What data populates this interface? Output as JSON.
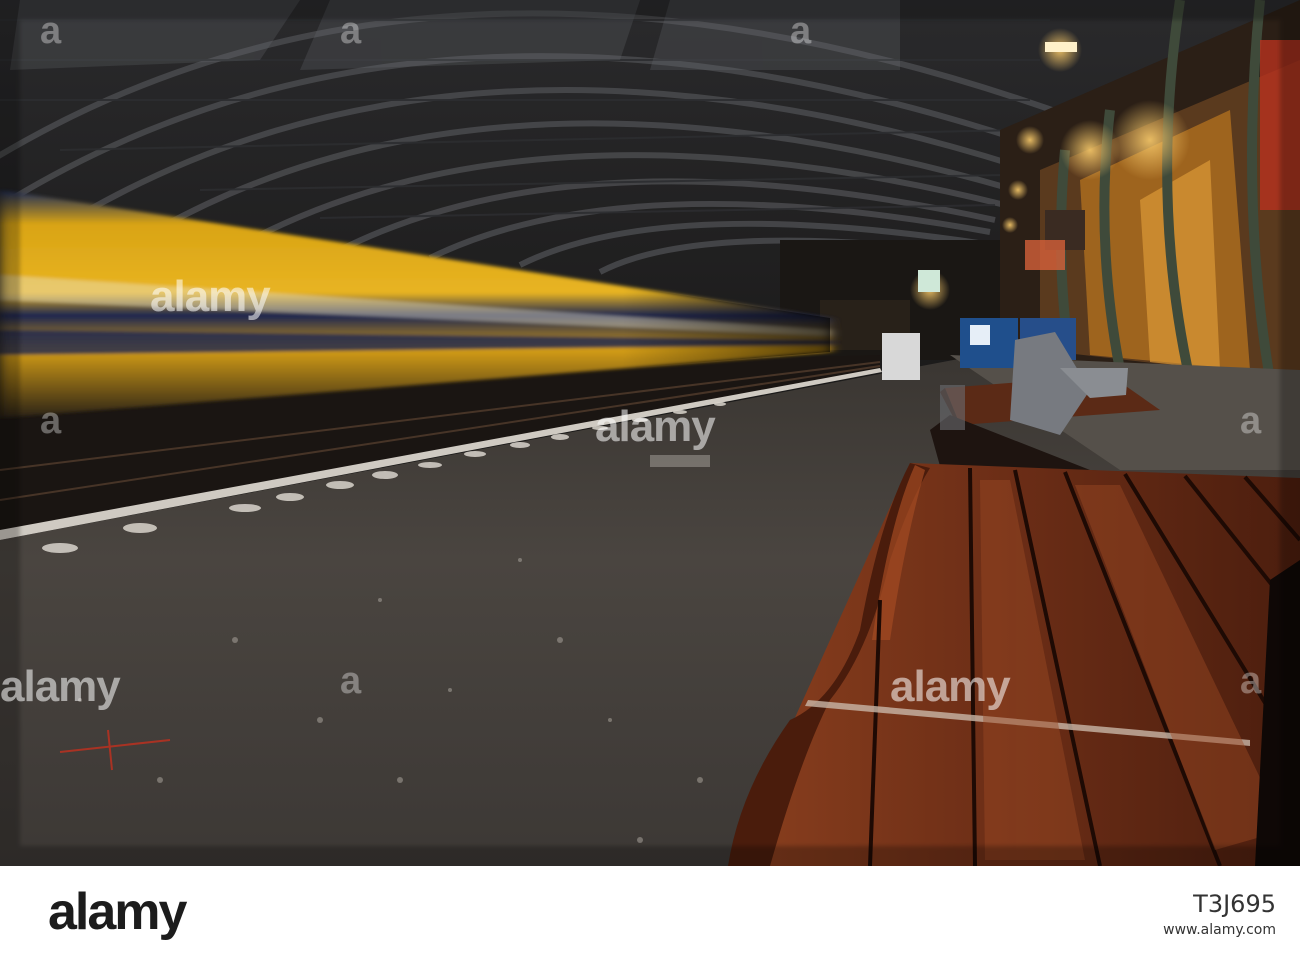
{
  "watermark": {
    "text": "alamy",
    "small_marks": "a"
  },
  "footer": {
    "logo": "alamy",
    "image_id": "T3J695",
    "url": "www.alamy.com"
  },
  "colors": {
    "train_yellow": "#e0a815",
    "train_blue": "#1a2a5a",
    "bench_wood": "#6b2d16",
    "platform": "#4a4540",
    "lamp": "#f2c66a"
  }
}
